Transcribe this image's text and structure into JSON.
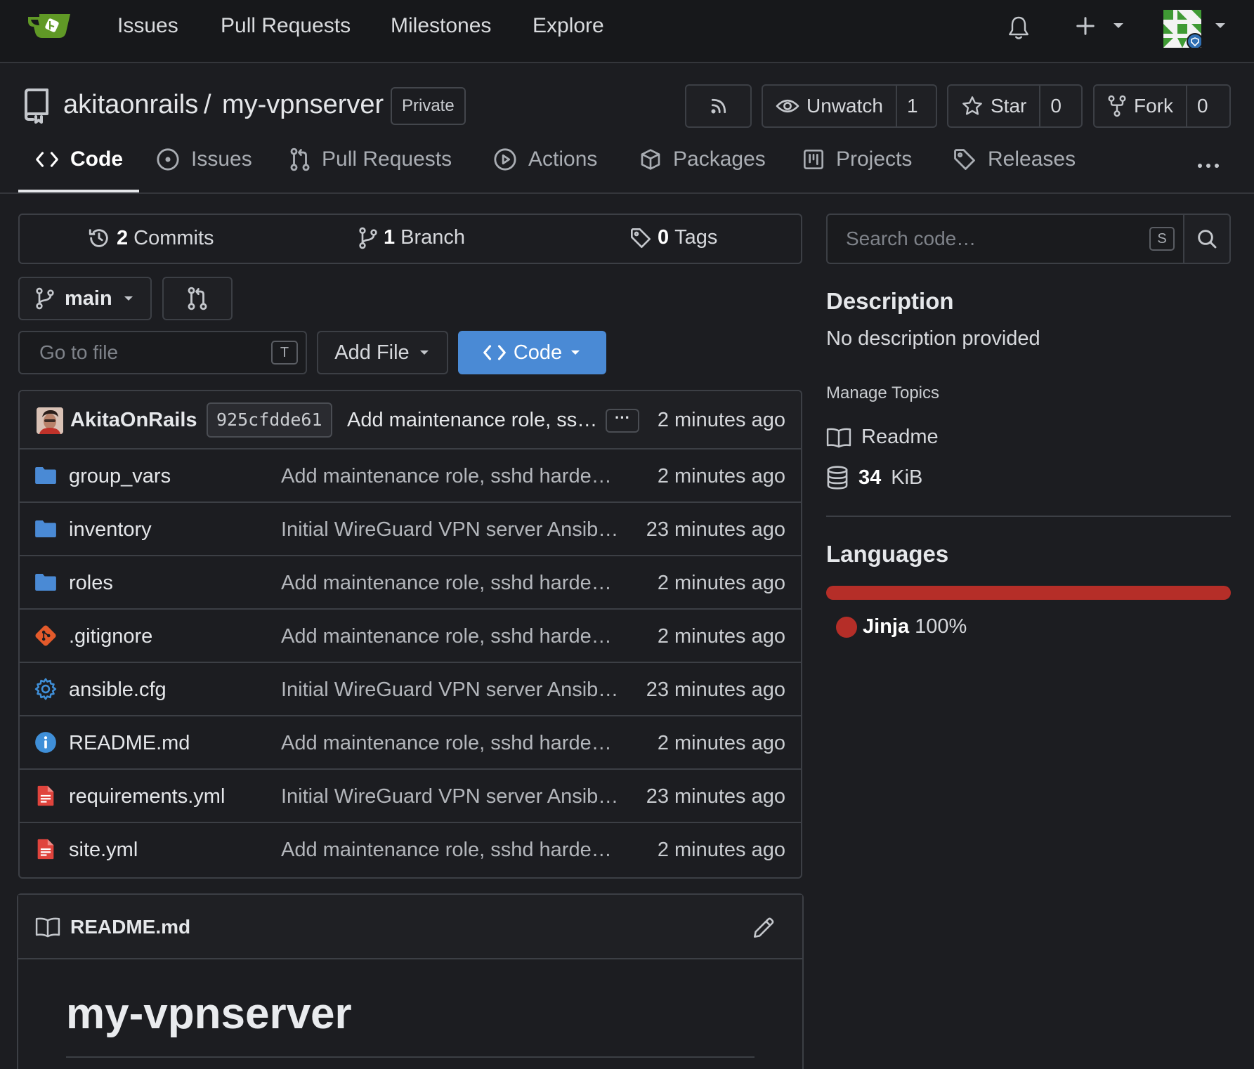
{
  "nav": {
    "links": [
      "Issues",
      "Pull Requests",
      "Milestones",
      "Explore"
    ]
  },
  "repo": {
    "owner": "akitaonrails",
    "separator": "/",
    "name": "my-vpnserver",
    "visibility": "Private",
    "unwatch_label": "Unwatch",
    "watch_count": "1",
    "star_label": "Star",
    "star_count": "0",
    "fork_label": "Fork",
    "fork_count": "0"
  },
  "tabs": [
    {
      "label": "Code",
      "icon": "code-icon",
      "active": true
    },
    {
      "label": "Issues",
      "icon": "issue-icon"
    },
    {
      "label": "Pull Requests",
      "icon": "pull-request-icon"
    },
    {
      "label": "Actions",
      "icon": "play-icon"
    },
    {
      "label": "Packages",
      "icon": "package-icon"
    },
    {
      "label": "Projects",
      "icon": "project-icon"
    },
    {
      "label": "Releases",
      "icon": "tag-icon"
    }
  ],
  "stats": {
    "commits_count": "2",
    "commits_label": "Commits",
    "branches_count": "1",
    "branches_label": "Branch",
    "tags_count": "0",
    "tags_label": "Tags"
  },
  "toolbar": {
    "branch": "main",
    "goto_placeholder": "Go to file",
    "goto_key": "T",
    "add_file": "Add File",
    "code": "Code"
  },
  "commit": {
    "author": "AkitaOnRails",
    "sha": "925cfdde61",
    "message": "Add maintenance role, ss…",
    "more": "···",
    "time": "2 minutes ago"
  },
  "files": [
    {
      "name": "group_vars",
      "type": "folder",
      "message": "Add maintenance role, sshd harde…",
      "time": "2 minutes ago"
    },
    {
      "name": "inventory",
      "type": "folder",
      "message": "Initial WireGuard VPN server Ansib…",
      "time": "23 minutes ago"
    },
    {
      "name": "roles",
      "type": "folder",
      "message": "Add maintenance role, sshd harde…",
      "time": "2 minutes ago"
    },
    {
      "name": ".gitignore",
      "type": "git",
      "message": "Add maintenance role, sshd harde…",
      "time": "2 minutes ago"
    },
    {
      "name": "ansible.cfg",
      "type": "config",
      "message": "Initial WireGuard VPN server Ansib…",
      "time": "23 minutes ago"
    },
    {
      "name": "README.md",
      "type": "info",
      "message": "Add maintenance role, sshd harde…",
      "time": "2 minutes ago"
    },
    {
      "name": "requirements.yml",
      "type": "yaml",
      "message": "Initial WireGuard VPN server Ansib…",
      "time": "23 minutes ago"
    },
    {
      "name": "site.yml",
      "type": "yaml",
      "message": "Add maintenance role, sshd harde…",
      "time": "2 minutes ago"
    }
  ],
  "readme": {
    "filename": "README.md",
    "heading": "my-vpnserver"
  },
  "sidebar": {
    "search_placeholder": "Search code…",
    "search_key": "S",
    "description_heading": "Description",
    "description": "No description provided",
    "manage_topics": "Manage Topics",
    "readme_link": "Readme",
    "size_value": "34",
    "size_unit": "KiB",
    "languages_heading": "Languages",
    "language_name": "Jinja",
    "language_percent": "100%"
  },
  "colors": {
    "accent": "#4a8ad5",
    "language_jinja": "#b52e28",
    "folder": "#4a8ad5",
    "git": "#e35a2b",
    "config": "#3f8fd8",
    "info": "#3f8fd8",
    "yaml": "#e0443d"
  }
}
